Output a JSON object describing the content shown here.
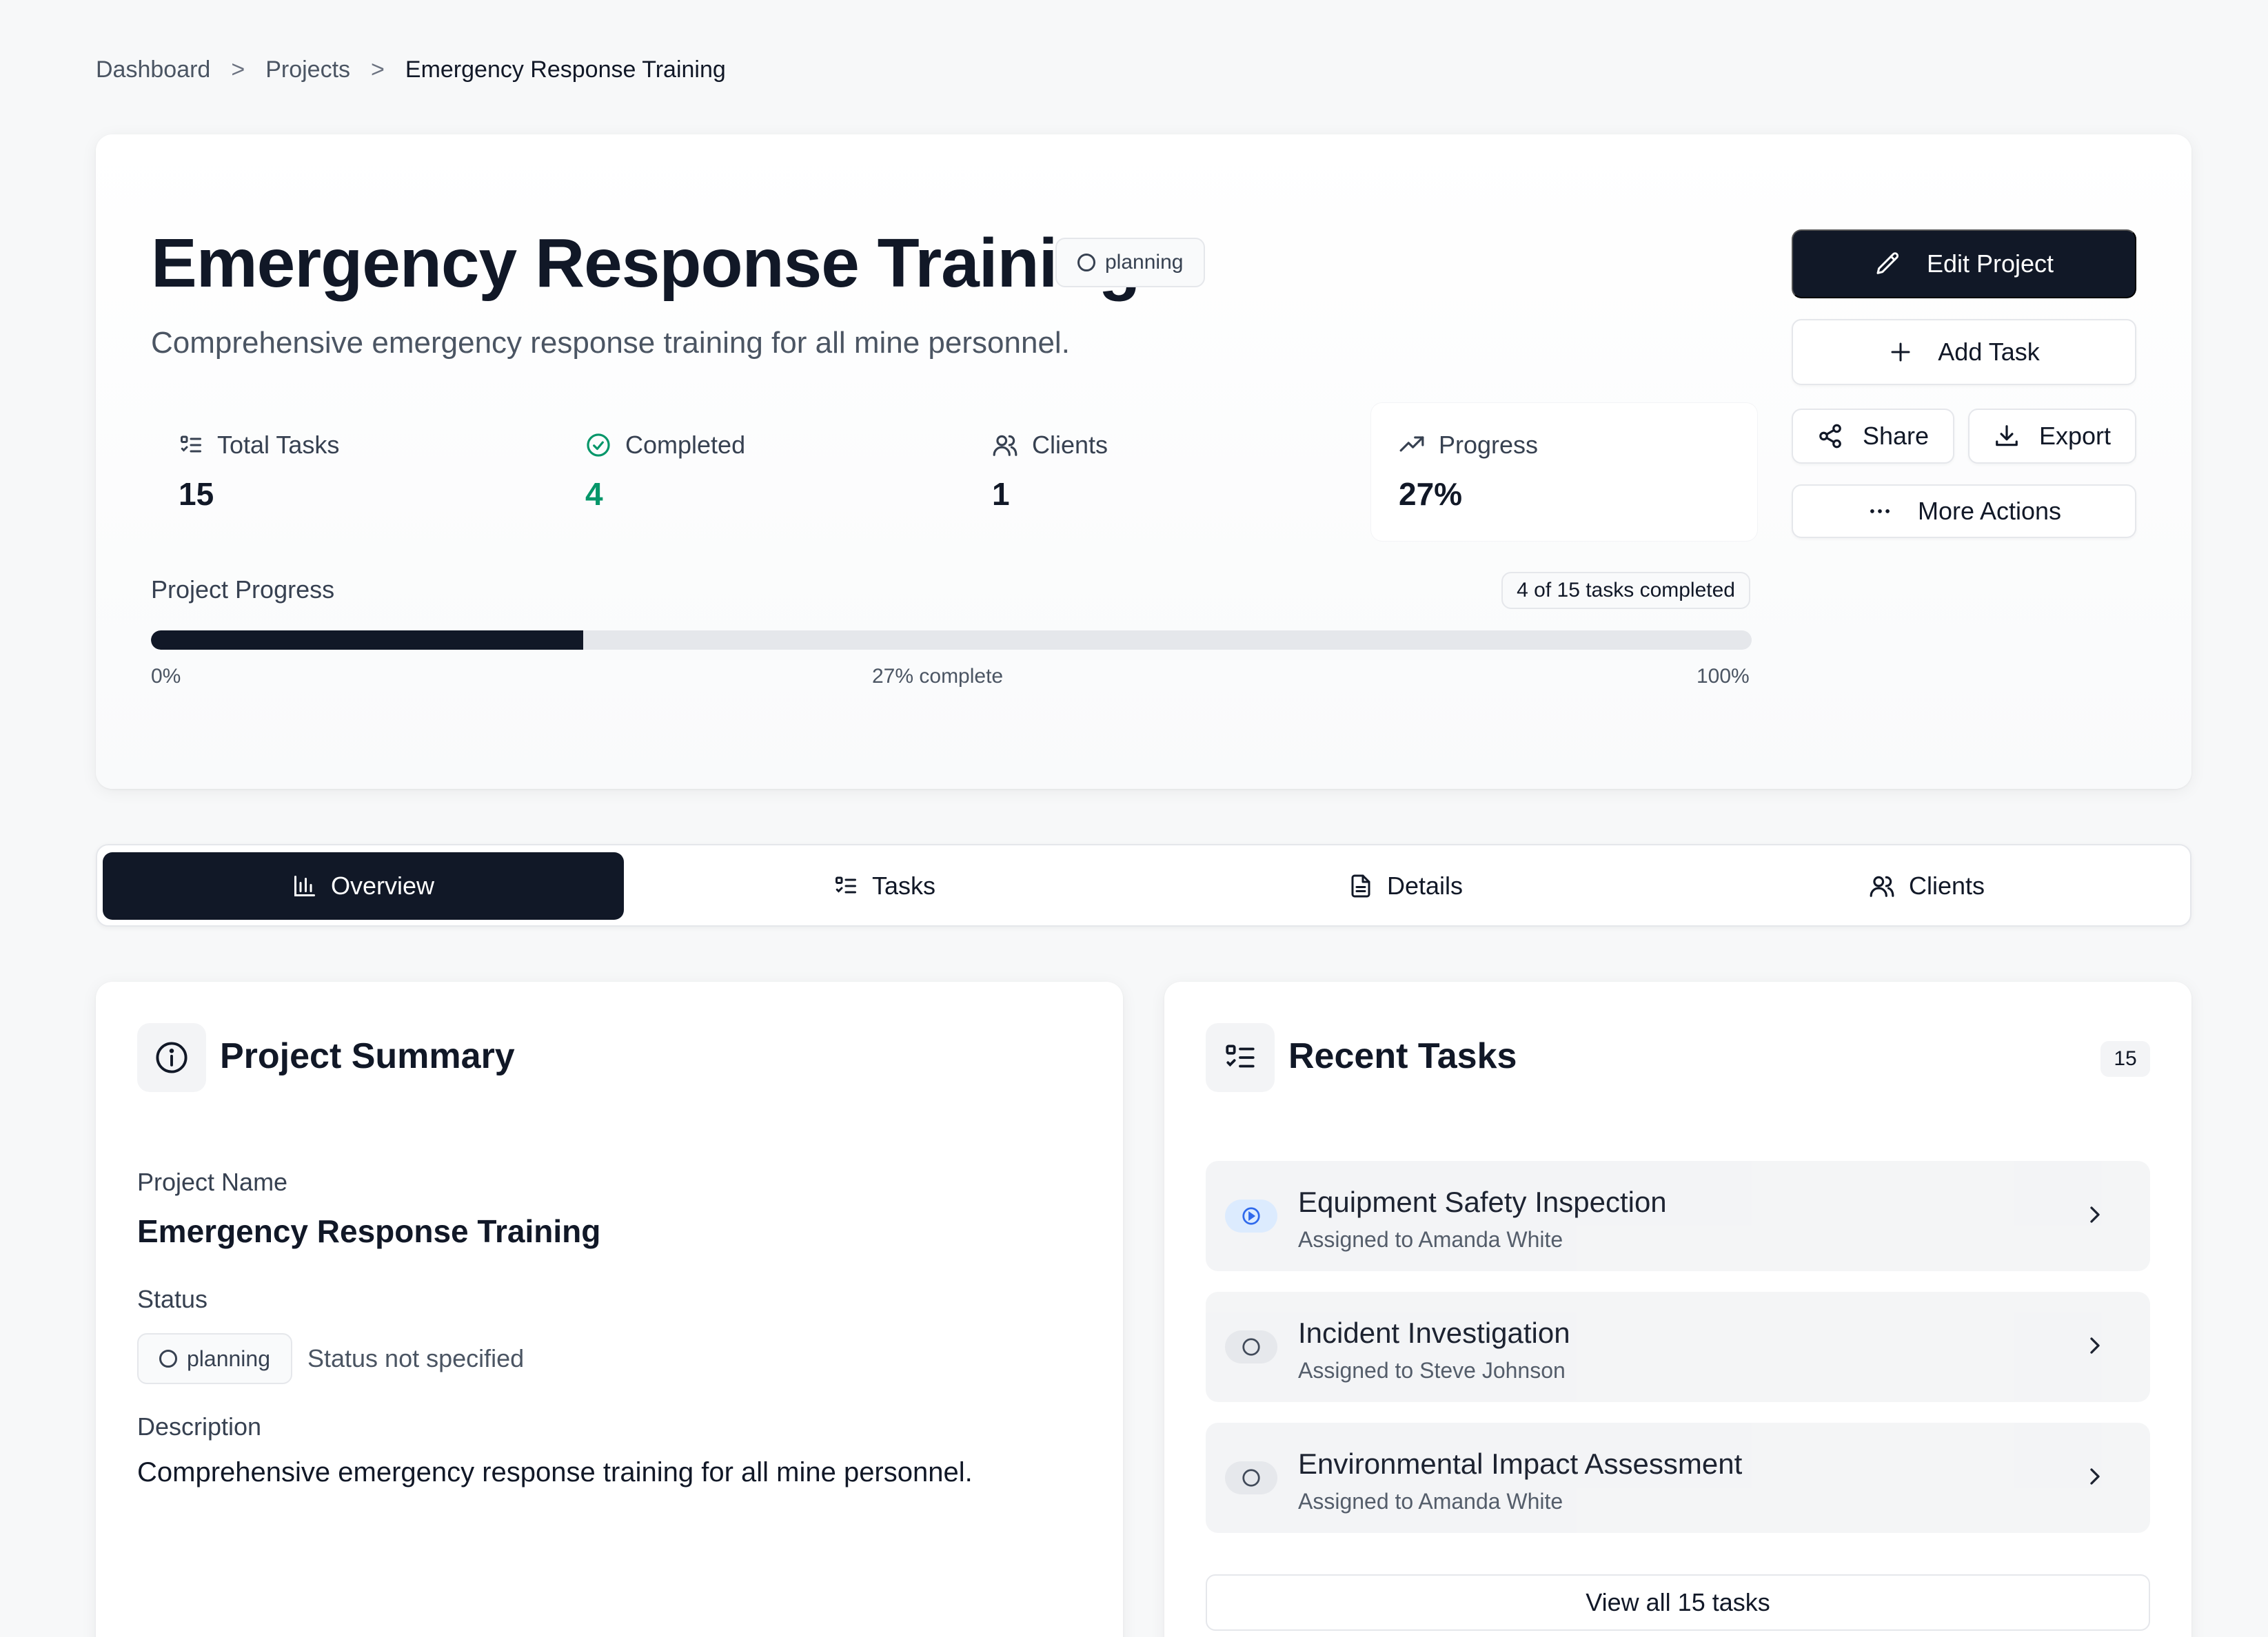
{
  "breadcrumb": {
    "items": [
      "Dashboard",
      "Projects",
      "Emergency Response Training"
    ],
    "separator": ">"
  },
  "header": {
    "title": "Emergency Response Training",
    "status_badge": "planning",
    "subtitle": "Comprehensive emergency response training for all mine personnel.",
    "stats": [
      {
        "label": "Total Tasks",
        "value": "15",
        "icon": "checklist-icon"
      },
      {
        "label": "Completed",
        "value": "4",
        "icon": "check-circle-icon"
      },
      {
        "label": "Clients",
        "value": "1",
        "icon": "users-icon"
      },
      {
        "label": "Progress",
        "value": "27%",
        "icon": "trending-up-icon"
      }
    ],
    "progress": {
      "label": "Project Progress",
      "summary": "4 of 15 tasks completed",
      "percent": 27,
      "min_label": "0%",
      "mid_label": "27% complete",
      "max_label": "100%"
    },
    "actions": {
      "edit": "Edit Project",
      "add_task": "Add Task",
      "share": "Share",
      "export": "Export",
      "more": "More Actions"
    }
  },
  "tabs": [
    {
      "label": "Overview",
      "icon": "bar-chart-icon",
      "active": true
    },
    {
      "label": "Tasks",
      "icon": "checklist-icon",
      "active": false
    },
    {
      "label": "Details",
      "icon": "document-icon",
      "active": false
    },
    {
      "label": "Clients",
      "icon": "users-icon",
      "active": false
    }
  ],
  "summary": {
    "title": "Project Summary",
    "name_label": "Project Name",
    "name_value": "Emergency Response Training",
    "status_label": "Status",
    "status_badge": "planning",
    "status_note": "Status not specified",
    "description_label": "Description",
    "description_value": "Comprehensive emergency response training for all mine personnel."
  },
  "recent_tasks": {
    "title": "Recent Tasks",
    "count": "15",
    "items": [
      {
        "name": "Equipment Safety Inspection",
        "assignee": "Assigned to Amanda White",
        "status": "in-progress"
      },
      {
        "name": "Incident Investigation",
        "assignee": "Assigned to Steve Johnson",
        "status": "todo"
      },
      {
        "name": "Environmental Impact Assessment",
        "assignee": "Assigned to Amanda White",
        "status": "todo"
      }
    ],
    "view_all": "View all 15 tasks"
  },
  "colors": {
    "primary": "#111827",
    "accent_green": "#059669",
    "accent_blue": "#2563eb",
    "track": "#e5e7eb"
  }
}
